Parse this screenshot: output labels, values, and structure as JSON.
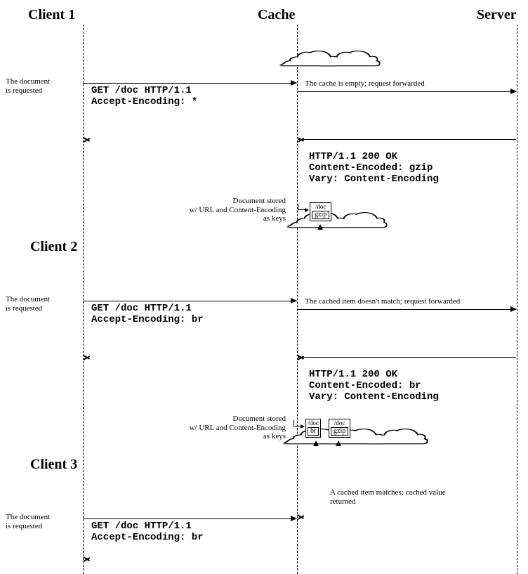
{
  "headers": {
    "client1": "Client 1",
    "cache": "Cache",
    "server": "Server"
  },
  "clients": {
    "c2": "Client 2",
    "c3": "Client 3"
  },
  "notes": {
    "req": "The document\nis requested",
    "cache_empty": "The cache is empty; request forwarded",
    "stored": "Document stored\nw/ URL and Content-Encoding\nas keys",
    "cache_miss": "The cached item doesn't match; request forwarded",
    "cache_hit": "A cached item matches; cached value\nreturned"
  },
  "req1": "GET /doc HTTP/1.1\nAccept-Encoding: *",
  "resp1": "HTTP/1.1 200 OK\nContent-Encoded: gzip\nVary: Content-Encoding",
  "req2": "GET /doc HTTP/1.1\nAccept-Encoding: br",
  "resp2": "HTTP/1.1 200 OK\nContent-Encoded: br\nVary: Content-Encoding",
  "req3": "GET /doc HTTP/1.1\nAccept-Encoding: br",
  "cache_entries": {
    "first": {
      "path": "/doc",
      "enc": "gzip"
    },
    "second_a": {
      "path": "/doc",
      "enc": "br"
    },
    "second_b": {
      "path": "/doc",
      "enc": "gzip"
    }
  }
}
